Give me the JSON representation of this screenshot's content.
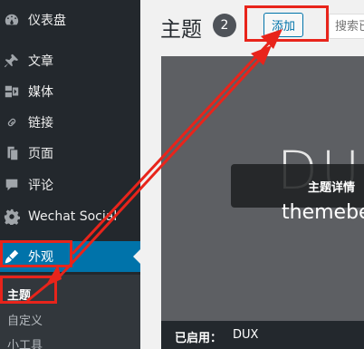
{
  "sidebar": {
    "items": [
      {
        "label": "仪表盘",
        "icon": "dashboard-icon"
      },
      {
        "label": "文章",
        "icon": "pin-icon"
      },
      {
        "label": "媒体",
        "icon": "media-icon"
      },
      {
        "label": "链接",
        "icon": "link-icon"
      },
      {
        "label": "页面",
        "icon": "page-icon"
      },
      {
        "label": "评论",
        "icon": "comment-icon"
      },
      {
        "label": "Wechat Social",
        "icon": "gear-icon"
      },
      {
        "label": "外观",
        "icon": "appearance-icon",
        "current": true
      }
    ],
    "submenu": [
      {
        "label": "主题",
        "current": true
      },
      {
        "label": "自定义"
      },
      {
        "label": "小工具"
      }
    ]
  },
  "header": {
    "title": "主题",
    "count": "2",
    "add_button": "添加",
    "search_placeholder": "搜索已"
  },
  "theme": {
    "logo": "DUX",
    "subtitle": "themebet",
    "details_label": "主题详情",
    "active_label": "已启用：",
    "active_name": "DUX"
  },
  "colors": {
    "sidebar": "#23282d",
    "submenu": "#32373c",
    "accent": "#0073aa",
    "annotation": "#e8241b"
  }
}
